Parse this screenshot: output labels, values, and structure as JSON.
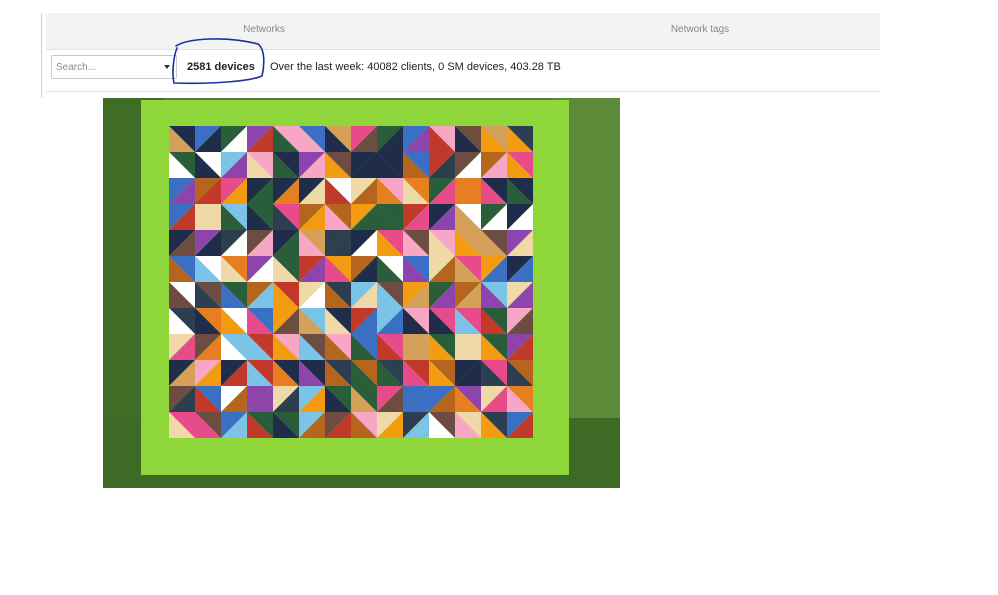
{
  "header": {
    "networks_label": "Networks",
    "network_tags_label": "Network tags"
  },
  "summary": {
    "search_placeholder": "Search...",
    "device_count": "2581 devices",
    "weekly_summary": "Over the last week: 40082 clients, 0 SM devices, 403.28 TB"
  },
  "annotation": {
    "color": "#1a2fa0"
  },
  "photo": {
    "subject": "patchwork quilt",
    "border_color": "#8fd63a",
    "background_color": "#4f7d2f"
  }
}
